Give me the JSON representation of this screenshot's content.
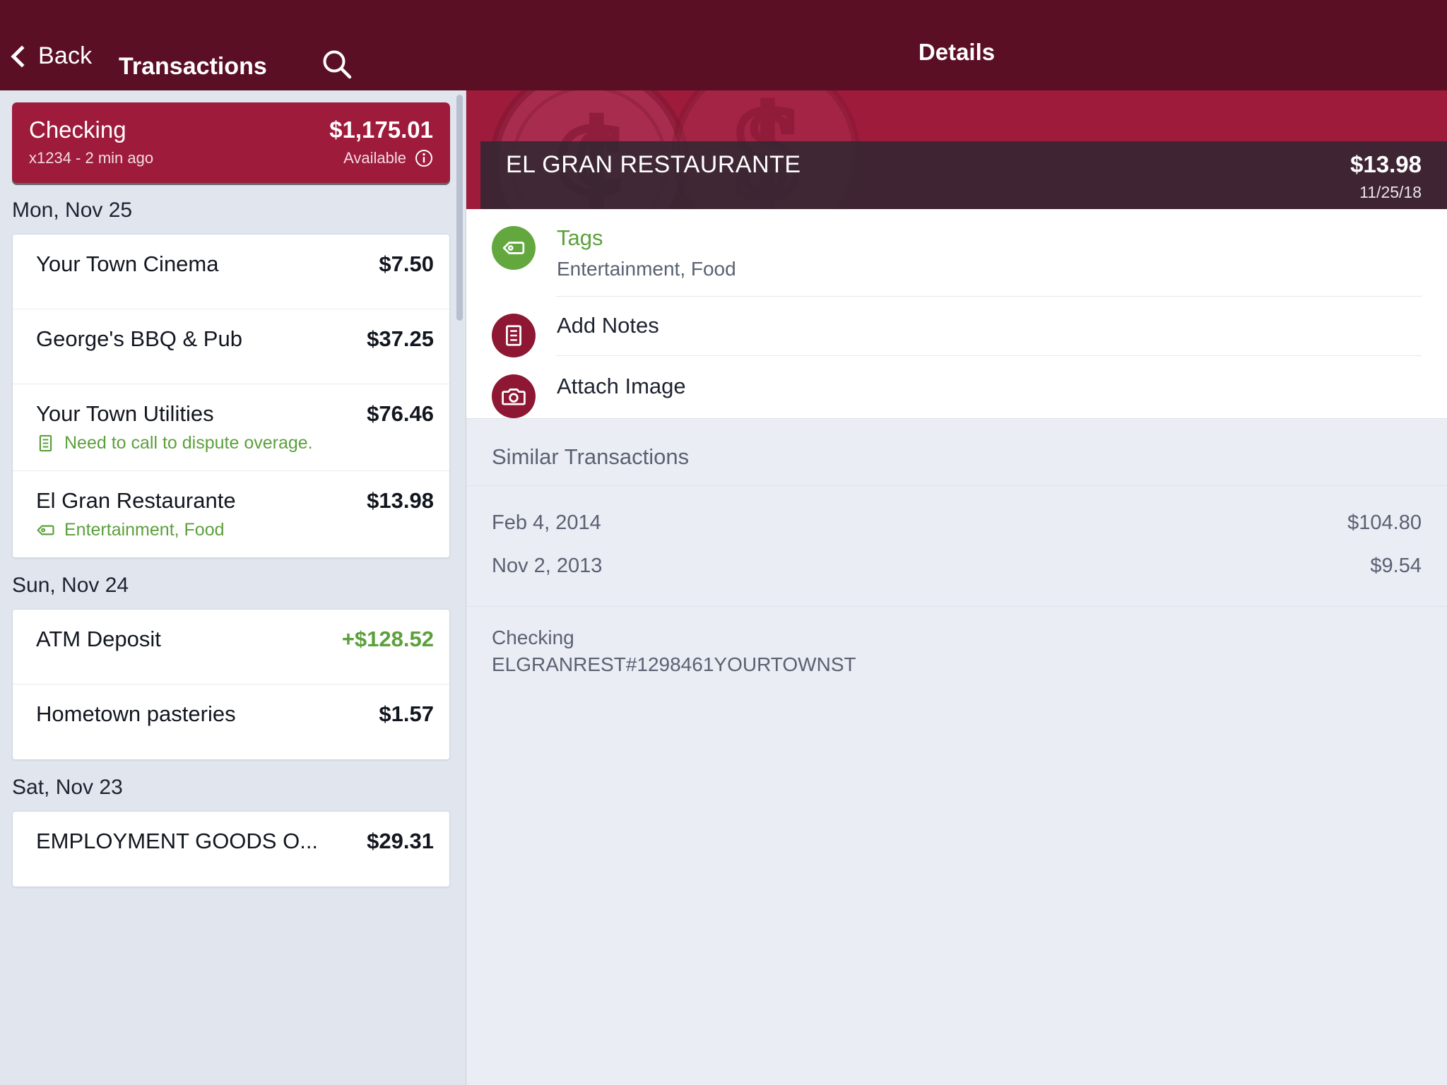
{
  "topbar": {
    "back_label": "Back",
    "list_title": "Transactions",
    "search_icon": "search-icon",
    "details_title": "Details"
  },
  "account_card": {
    "name": "Checking",
    "balance": "$1,175.01",
    "sub": "x1234 - 2 min ago",
    "available_label": "Available",
    "info_icon": "info-icon"
  },
  "groups": [
    {
      "date_label": "Mon, Nov 25",
      "transactions": [
        {
          "name": "Your Town Cinema",
          "amount": "$7.50",
          "credit": false
        },
        {
          "name": "George's BBQ & Pub",
          "amount": "$37.25",
          "credit": false
        },
        {
          "name": "Your Town Utilities",
          "amount": "$76.46",
          "credit": false,
          "sub_text": "Need to call to dispute overage.",
          "sub_icon": "note-icon"
        },
        {
          "name": "El Gran Restaurante",
          "amount": "$13.98",
          "credit": false,
          "sub_text": "Entertainment, Food",
          "sub_icon": "tag-icon"
        }
      ]
    },
    {
      "date_label": "Sun, Nov 24",
      "transactions": [
        {
          "name": "ATM Deposit",
          "amount": "+$128.52",
          "credit": true
        },
        {
          "name": "Hometown pasteries",
          "amount": "$1.57",
          "credit": false
        }
      ]
    },
    {
      "date_label": "Sat, Nov 23",
      "transactions": [
        {
          "name": "EMPLOYMENT GOODS O...",
          "amount": "$29.31",
          "credit": false
        }
      ]
    }
  ],
  "detail": {
    "merchant": "EL GRAN RESTAURANTE",
    "amount": "$13.98",
    "date": "11/25/18",
    "actions": [
      {
        "title": "Tags",
        "sub": "Entertainment, Food",
        "icon": "tag-icon",
        "color": "green"
      },
      {
        "title": "Add Notes",
        "sub": "",
        "icon": "note-icon",
        "color": "maroon"
      },
      {
        "title": "Attach Image",
        "sub": "",
        "icon": "camera-icon",
        "color": "maroon"
      }
    ],
    "similar_header": "Similar Transactions",
    "similar": [
      {
        "date": "Feb 4, 2014",
        "amount": "$104.80"
      },
      {
        "date": "Nov 2, 2013",
        "amount": "$9.54"
      }
    ],
    "account_name": "Checking",
    "account_descriptor": "ELGRANREST#1298461YOURTOWNST"
  },
  "colors": {
    "brand_dark": "#5a0f25",
    "brand": "#9e1b3c",
    "green": "#5ca03c",
    "panel_bg": "#eaedf4"
  }
}
